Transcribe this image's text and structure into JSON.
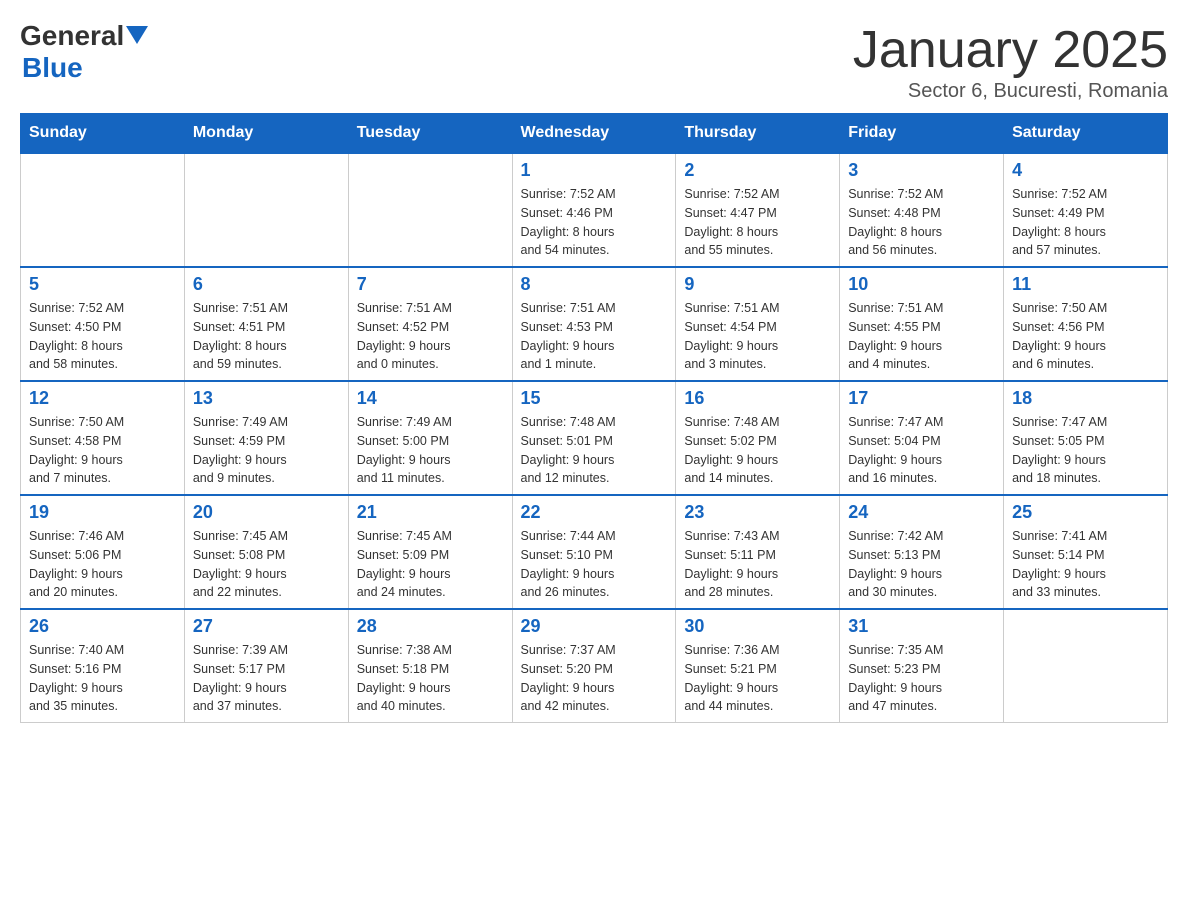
{
  "header": {
    "logo": {
      "general": "General",
      "arrow": "▶",
      "blue": "Blue"
    },
    "title": "January 2025",
    "subtitle": "Sector 6, Bucuresti, Romania"
  },
  "days_of_week": [
    "Sunday",
    "Monday",
    "Tuesday",
    "Wednesday",
    "Thursday",
    "Friday",
    "Saturday"
  ],
  "weeks": [
    [
      {
        "day": "",
        "info": ""
      },
      {
        "day": "",
        "info": ""
      },
      {
        "day": "",
        "info": ""
      },
      {
        "day": "1",
        "info": "Sunrise: 7:52 AM\nSunset: 4:46 PM\nDaylight: 8 hours\nand 54 minutes."
      },
      {
        "day": "2",
        "info": "Sunrise: 7:52 AM\nSunset: 4:47 PM\nDaylight: 8 hours\nand 55 minutes."
      },
      {
        "day": "3",
        "info": "Sunrise: 7:52 AM\nSunset: 4:48 PM\nDaylight: 8 hours\nand 56 minutes."
      },
      {
        "day": "4",
        "info": "Sunrise: 7:52 AM\nSunset: 4:49 PM\nDaylight: 8 hours\nand 57 minutes."
      }
    ],
    [
      {
        "day": "5",
        "info": "Sunrise: 7:52 AM\nSunset: 4:50 PM\nDaylight: 8 hours\nand 58 minutes."
      },
      {
        "day": "6",
        "info": "Sunrise: 7:51 AM\nSunset: 4:51 PM\nDaylight: 8 hours\nand 59 minutes."
      },
      {
        "day": "7",
        "info": "Sunrise: 7:51 AM\nSunset: 4:52 PM\nDaylight: 9 hours\nand 0 minutes."
      },
      {
        "day": "8",
        "info": "Sunrise: 7:51 AM\nSunset: 4:53 PM\nDaylight: 9 hours\nand 1 minute."
      },
      {
        "day": "9",
        "info": "Sunrise: 7:51 AM\nSunset: 4:54 PM\nDaylight: 9 hours\nand 3 minutes."
      },
      {
        "day": "10",
        "info": "Sunrise: 7:51 AM\nSunset: 4:55 PM\nDaylight: 9 hours\nand 4 minutes."
      },
      {
        "day": "11",
        "info": "Sunrise: 7:50 AM\nSunset: 4:56 PM\nDaylight: 9 hours\nand 6 minutes."
      }
    ],
    [
      {
        "day": "12",
        "info": "Sunrise: 7:50 AM\nSunset: 4:58 PM\nDaylight: 9 hours\nand 7 minutes."
      },
      {
        "day": "13",
        "info": "Sunrise: 7:49 AM\nSunset: 4:59 PM\nDaylight: 9 hours\nand 9 minutes."
      },
      {
        "day": "14",
        "info": "Sunrise: 7:49 AM\nSunset: 5:00 PM\nDaylight: 9 hours\nand 11 minutes."
      },
      {
        "day": "15",
        "info": "Sunrise: 7:48 AM\nSunset: 5:01 PM\nDaylight: 9 hours\nand 12 minutes."
      },
      {
        "day": "16",
        "info": "Sunrise: 7:48 AM\nSunset: 5:02 PM\nDaylight: 9 hours\nand 14 minutes."
      },
      {
        "day": "17",
        "info": "Sunrise: 7:47 AM\nSunset: 5:04 PM\nDaylight: 9 hours\nand 16 minutes."
      },
      {
        "day": "18",
        "info": "Sunrise: 7:47 AM\nSunset: 5:05 PM\nDaylight: 9 hours\nand 18 minutes."
      }
    ],
    [
      {
        "day": "19",
        "info": "Sunrise: 7:46 AM\nSunset: 5:06 PM\nDaylight: 9 hours\nand 20 minutes."
      },
      {
        "day": "20",
        "info": "Sunrise: 7:45 AM\nSunset: 5:08 PM\nDaylight: 9 hours\nand 22 minutes."
      },
      {
        "day": "21",
        "info": "Sunrise: 7:45 AM\nSunset: 5:09 PM\nDaylight: 9 hours\nand 24 minutes."
      },
      {
        "day": "22",
        "info": "Sunrise: 7:44 AM\nSunset: 5:10 PM\nDaylight: 9 hours\nand 26 minutes."
      },
      {
        "day": "23",
        "info": "Sunrise: 7:43 AM\nSunset: 5:11 PM\nDaylight: 9 hours\nand 28 minutes."
      },
      {
        "day": "24",
        "info": "Sunrise: 7:42 AM\nSunset: 5:13 PM\nDaylight: 9 hours\nand 30 minutes."
      },
      {
        "day": "25",
        "info": "Sunrise: 7:41 AM\nSunset: 5:14 PM\nDaylight: 9 hours\nand 33 minutes."
      }
    ],
    [
      {
        "day": "26",
        "info": "Sunrise: 7:40 AM\nSunset: 5:16 PM\nDaylight: 9 hours\nand 35 minutes."
      },
      {
        "day": "27",
        "info": "Sunrise: 7:39 AM\nSunset: 5:17 PM\nDaylight: 9 hours\nand 37 minutes."
      },
      {
        "day": "28",
        "info": "Sunrise: 7:38 AM\nSunset: 5:18 PM\nDaylight: 9 hours\nand 40 minutes."
      },
      {
        "day": "29",
        "info": "Sunrise: 7:37 AM\nSunset: 5:20 PM\nDaylight: 9 hours\nand 42 minutes."
      },
      {
        "day": "30",
        "info": "Sunrise: 7:36 AM\nSunset: 5:21 PM\nDaylight: 9 hours\nand 44 minutes."
      },
      {
        "day": "31",
        "info": "Sunrise: 7:35 AM\nSunset: 5:23 PM\nDaylight: 9 hours\nand 47 minutes."
      },
      {
        "day": "",
        "info": ""
      }
    ]
  ]
}
